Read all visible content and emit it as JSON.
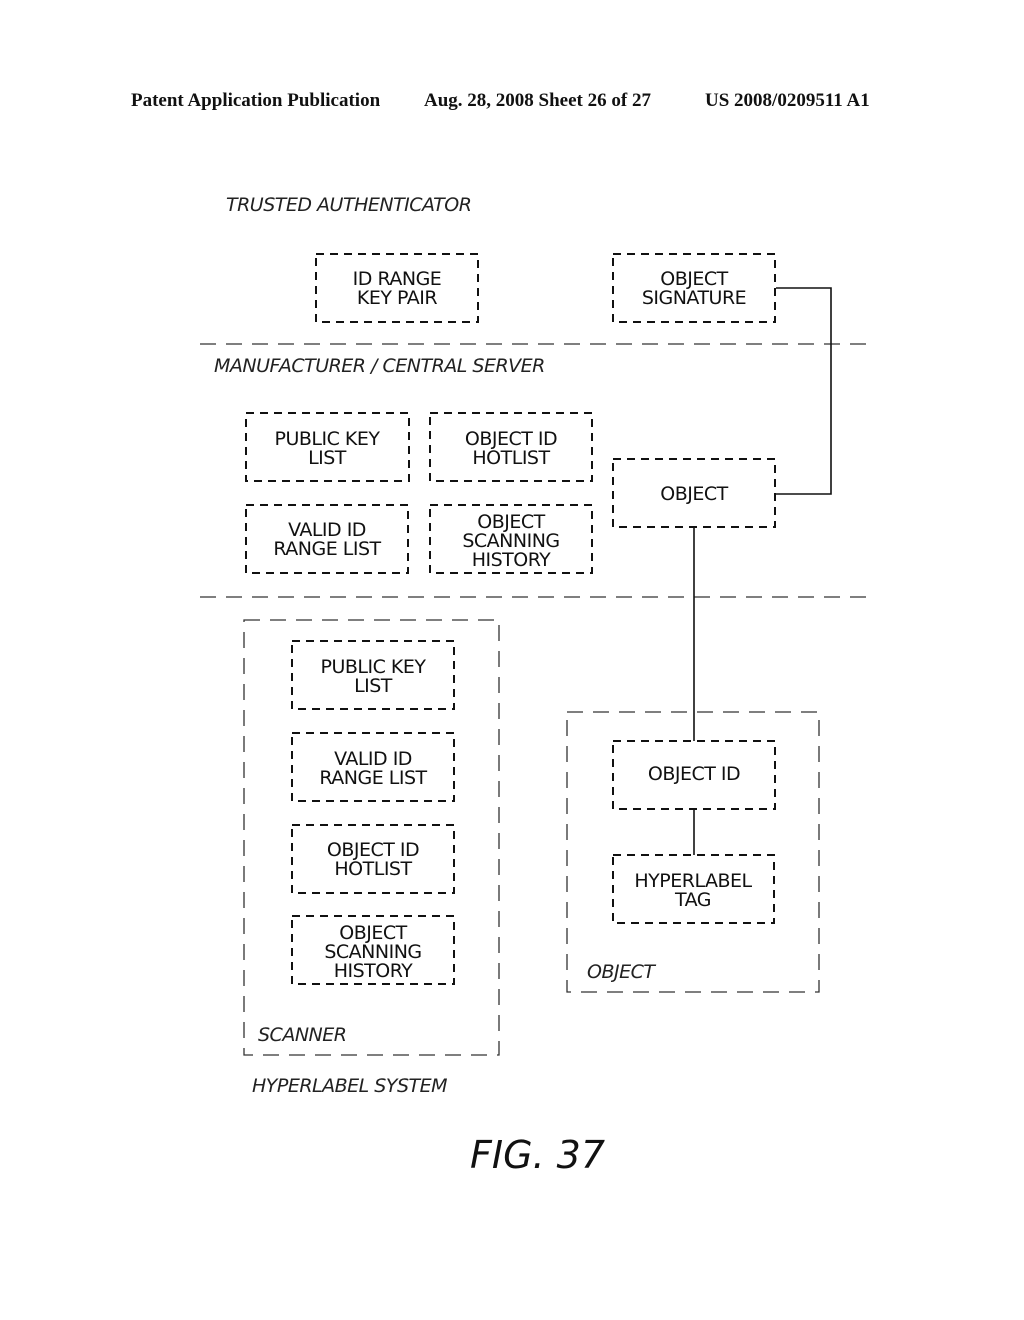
{
  "header": {
    "publication": "Patent Application Publication",
    "date_sheet": "Aug. 28, 2008  Sheet 26 of 27",
    "patent_number": "US 2008/0209511 A1"
  },
  "sections": {
    "trusted_authenticator": "TRUSTED AUTHENTICATOR",
    "manufacturer": "MANUFACTURER / CENTRAL SERVER",
    "hyperlabel_system": "HYPERLABEL SYSTEM"
  },
  "groups": {
    "scanner": "SCANNER",
    "object": "OBJECT"
  },
  "boxes": {
    "id_range_key_pair": [
      "ID RANGE",
      "KEY PAIR"
    ],
    "object_signature": [
      "OBJECT",
      "SIGNATURE"
    ],
    "server_public_key_list": [
      "PUBLIC KEY",
      "LIST"
    ],
    "server_object_id_hotlist": [
      "OBJECT ID",
      "HOTLIST"
    ],
    "server_valid_id_range_list": [
      "VALID ID",
      "RANGE LIST"
    ],
    "server_object_scanning_history": [
      "OBJECT",
      "SCANNING",
      "HISTORY"
    ],
    "server_object": [
      "OBJECT"
    ],
    "scanner_public_key_list": [
      "PUBLIC KEY",
      "LIST"
    ],
    "scanner_valid_id_range_list": [
      "VALID ID",
      "RANGE LIST"
    ],
    "scanner_object_id_hotlist": [
      "OBJECT ID",
      "HOTLIST"
    ],
    "scanner_object_scanning_history": [
      "OBJECT",
      "SCANNING",
      "HISTORY"
    ],
    "object_id": [
      "OBJECT ID"
    ],
    "hyperlabel_tag": [
      "HYPERLABEL",
      "TAG"
    ]
  },
  "figure_label": "FIG. 37"
}
